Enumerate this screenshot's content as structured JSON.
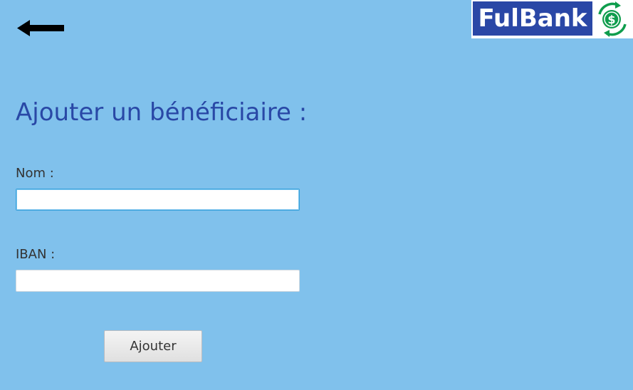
{
  "header": {
    "back_icon": "arrow-left-icon",
    "logo_text": "FulBank",
    "logo_icon": "dollar-exchange-icon"
  },
  "form": {
    "title": "Ajouter un bénéficiaire :",
    "nom_label": "Nom :",
    "nom_value": "",
    "iban_label": "IBAN :",
    "iban_value": "",
    "submit_label": "Ajouter"
  },
  "colors": {
    "background": "#80c1ec",
    "title": "#2948a6",
    "logo_box": "#2a47a6",
    "logo_icon": "#0f9d4d"
  }
}
